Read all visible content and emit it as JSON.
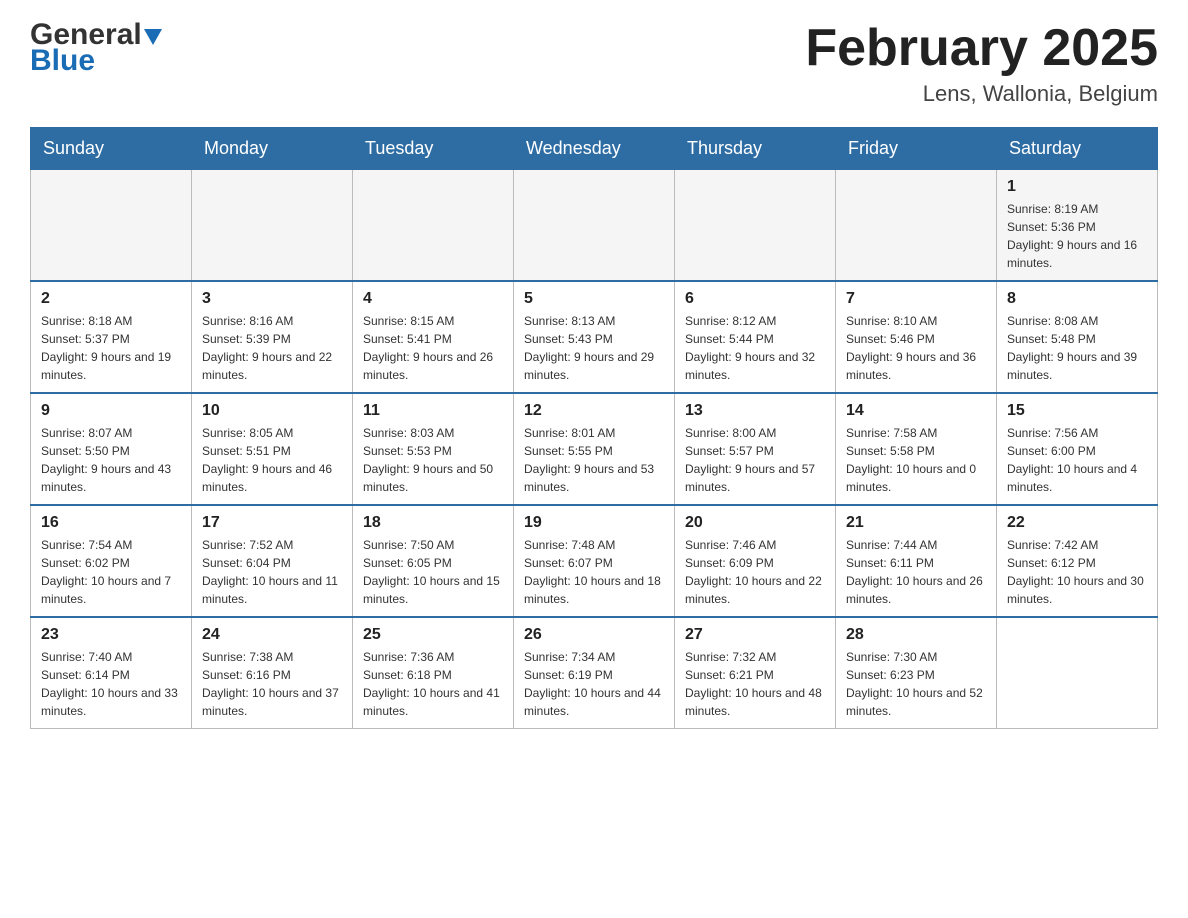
{
  "header": {
    "logo_text_general": "General",
    "logo_text_blue": "Blue",
    "month_title": "February 2025",
    "location": "Lens, Wallonia, Belgium"
  },
  "days_of_week": [
    "Sunday",
    "Monday",
    "Tuesday",
    "Wednesday",
    "Thursday",
    "Friday",
    "Saturday"
  ],
  "weeks": [
    {
      "days": [
        {
          "number": "",
          "info": ""
        },
        {
          "number": "",
          "info": ""
        },
        {
          "number": "",
          "info": ""
        },
        {
          "number": "",
          "info": ""
        },
        {
          "number": "",
          "info": ""
        },
        {
          "number": "",
          "info": ""
        },
        {
          "number": "1",
          "info": "Sunrise: 8:19 AM\nSunset: 5:36 PM\nDaylight: 9 hours and 16 minutes."
        }
      ]
    },
    {
      "days": [
        {
          "number": "2",
          "info": "Sunrise: 8:18 AM\nSunset: 5:37 PM\nDaylight: 9 hours and 19 minutes."
        },
        {
          "number": "3",
          "info": "Sunrise: 8:16 AM\nSunset: 5:39 PM\nDaylight: 9 hours and 22 minutes."
        },
        {
          "number": "4",
          "info": "Sunrise: 8:15 AM\nSunset: 5:41 PM\nDaylight: 9 hours and 26 minutes."
        },
        {
          "number": "5",
          "info": "Sunrise: 8:13 AM\nSunset: 5:43 PM\nDaylight: 9 hours and 29 minutes."
        },
        {
          "number": "6",
          "info": "Sunrise: 8:12 AM\nSunset: 5:44 PM\nDaylight: 9 hours and 32 minutes."
        },
        {
          "number": "7",
          "info": "Sunrise: 8:10 AM\nSunset: 5:46 PM\nDaylight: 9 hours and 36 minutes."
        },
        {
          "number": "8",
          "info": "Sunrise: 8:08 AM\nSunset: 5:48 PM\nDaylight: 9 hours and 39 minutes."
        }
      ]
    },
    {
      "days": [
        {
          "number": "9",
          "info": "Sunrise: 8:07 AM\nSunset: 5:50 PM\nDaylight: 9 hours and 43 minutes."
        },
        {
          "number": "10",
          "info": "Sunrise: 8:05 AM\nSunset: 5:51 PM\nDaylight: 9 hours and 46 minutes."
        },
        {
          "number": "11",
          "info": "Sunrise: 8:03 AM\nSunset: 5:53 PM\nDaylight: 9 hours and 50 minutes."
        },
        {
          "number": "12",
          "info": "Sunrise: 8:01 AM\nSunset: 5:55 PM\nDaylight: 9 hours and 53 minutes."
        },
        {
          "number": "13",
          "info": "Sunrise: 8:00 AM\nSunset: 5:57 PM\nDaylight: 9 hours and 57 minutes."
        },
        {
          "number": "14",
          "info": "Sunrise: 7:58 AM\nSunset: 5:58 PM\nDaylight: 10 hours and 0 minutes."
        },
        {
          "number": "15",
          "info": "Sunrise: 7:56 AM\nSunset: 6:00 PM\nDaylight: 10 hours and 4 minutes."
        }
      ]
    },
    {
      "days": [
        {
          "number": "16",
          "info": "Sunrise: 7:54 AM\nSunset: 6:02 PM\nDaylight: 10 hours and 7 minutes."
        },
        {
          "number": "17",
          "info": "Sunrise: 7:52 AM\nSunset: 6:04 PM\nDaylight: 10 hours and 11 minutes."
        },
        {
          "number": "18",
          "info": "Sunrise: 7:50 AM\nSunset: 6:05 PM\nDaylight: 10 hours and 15 minutes."
        },
        {
          "number": "19",
          "info": "Sunrise: 7:48 AM\nSunset: 6:07 PM\nDaylight: 10 hours and 18 minutes."
        },
        {
          "number": "20",
          "info": "Sunrise: 7:46 AM\nSunset: 6:09 PM\nDaylight: 10 hours and 22 minutes."
        },
        {
          "number": "21",
          "info": "Sunrise: 7:44 AM\nSunset: 6:11 PM\nDaylight: 10 hours and 26 minutes."
        },
        {
          "number": "22",
          "info": "Sunrise: 7:42 AM\nSunset: 6:12 PM\nDaylight: 10 hours and 30 minutes."
        }
      ]
    },
    {
      "days": [
        {
          "number": "23",
          "info": "Sunrise: 7:40 AM\nSunset: 6:14 PM\nDaylight: 10 hours and 33 minutes."
        },
        {
          "number": "24",
          "info": "Sunrise: 7:38 AM\nSunset: 6:16 PM\nDaylight: 10 hours and 37 minutes."
        },
        {
          "number": "25",
          "info": "Sunrise: 7:36 AM\nSunset: 6:18 PM\nDaylight: 10 hours and 41 minutes."
        },
        {
          "number": "26",
          "info": "Sunrise: 7:34 AM\nSunset: 6:19 PM\nDaylight: 10 hours and 44 minutes."
        },
        {
          "number": "27",
          "info": "Sunrise: 7:32 AM\nSunset: 6:21 PM\nDaylight: 10 hours and 48 minutes."
        },
        {
          "number": "28",
          "info": "Sunrise: 7:30 AM\nSunset: 6:23 PM\nDaylight: 10 hours and 52 minutes."
        },
        {
          "number": "",
          "info": ""
        }
      ]
    }
  ]
}
